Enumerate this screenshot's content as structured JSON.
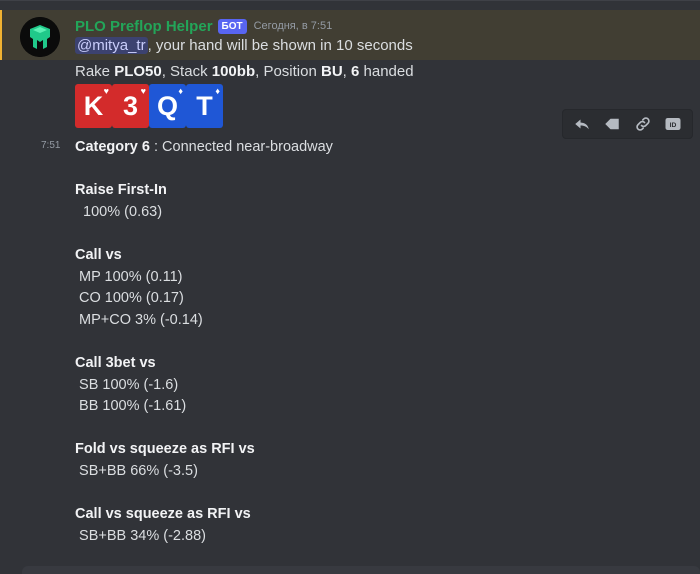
{
  "bot": {
    "username": "PLO Preflop Helper",
    "tag": "БОТ",
    "timestamp": "Сегодня, в 7:51",
    "avatar_icon": "logo-icon"
  },
  "message1": {
    "mention": "@mitya_tr",
    "text": ", your hand will be shown in 10 seconds"
  },
  "message2": {
    "parts": [
      "Rake ",
      "PLO50",
      ", Stack ",
      "100bb",
      ", Position ",
      "BU",
      ", ",
      "6",
      " handed"
    ]
  },
  "cards": [
    {
      "rank": "K",
      "suit": "♥",
      "color": "#d32b2b"
    },
    {
      "rank": "3",
      "suit": "♥",
      "color": "#d32b2b"
    },
    {
      "rank": "Q",
      "suit": "♦",
      "color": "#1f57d6"
    },
    {
      "rank": "T",
      "suit": "♦",
      "color": "#1f57d6"
    }
  ],
  "toolbar": {
    "reply_icon": "reply-icon",
    "forward_icon": "forward-icon",
    "link_icon": "link-icon",
    "id_icon": "id-icon",
    "id_label": "ID"
  },
  "side_time": "7:51",
  "content": {
    "category_label": "Category 6",
    "category_text": " : Connected near-broadway",
    "rfi_header": "Raise First-In",
    "rfi_value": "  100% (0.63)",
    "call_header": "Call vs",
    "call_lines": [
      " MP 100% (0.11)",
      " CO 100% (0.17)",
      " MP+CO 3% (-0.14)"
    ],
    "call3bet_header": "Call 3bet vs",
    "call3bet_lines": [
      " SB 100% (-1.6)",
      " BB 100% (-1.61)"
    ],
    "fold_sq_header": "Fold vs squeeze as RFI vs",
    "fold_sq_lines": [
      " SB+BB 66% (-3.5)"
    ],
    "call_sq_header": "Call vs squeeze as RFI vs",
    "call_sq_lines": [
      " SB+BB 34% (-2.88)"
    ]
  },
  "colors": {
    "background": "#313338",
    "highlight": "#413e33",
    "highlight_bar": "#f0b232",
    "username": "#23a559",
    "bot_tag": "#5865f2",
    "mention_bg": "#3c4270"
  }
}
